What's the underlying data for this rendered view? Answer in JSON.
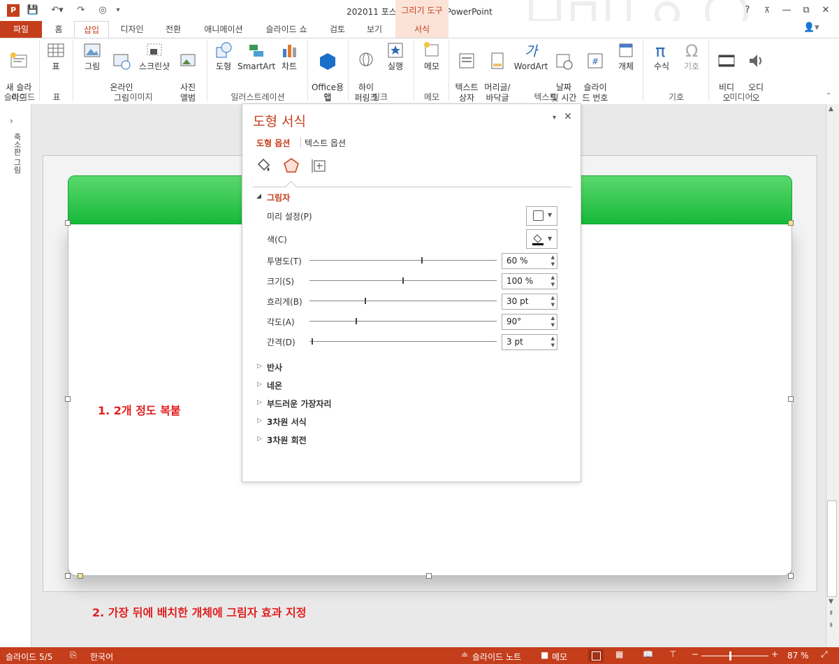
{
  "window": {
    "title": "202011 포스팅용 완성본 - PowerPoint",
    "contextual_title": "그리기 도구",
    "help": "?",
    "minimize": "—",
    "restore": "⧉",
    "close": "✕"
  },
  "tabs": [
    "파일",
    "홈",
    "삽입",
    "디자인",
    "전환",
    "애니메이션",
    "슬라이드 쇼",
    "검토",
    "보기",
    "서식"
  ],
  "ribbon": {
    "new_slide": "새 슬라\n이드",
    "table": "표",
    "picture": "그림",
    "online_picture": "온라인\n그림",
    "screenshot": "스크린샷",
    "photo_album": "사진\n앨범",
    "shapes": "도형",
    "smartart": "SmartArt",
    "chart": "차트",
    "office_app": "Office용\n앱",
    "hyperlink": "하이\n퍼링크",
    "action": "실행",
    "comment": "메모",
    "textbox": "텍스트\n상자",
    "header_footer": "머리글/\n바닥글",
    "wordart": "WordArt",
    "date_time": "날짜\n및 시간",
    "slide_number": "슬라이\n드 번호",
    "object": "개체",
    "equation": "수식",
    "symbol": "기호",
    "video": "비디\n오",
    "audio": "오디\n오",
    "groups": {
      "slides": "슬라이드",
      "tables": "표",
      "images": "이미지",
      "illustrations": "일러스트레이션",
      "apps": "앱",
      "links": "링크",
      "comments": "메모",
      "text": "텍스트",
      "symbols": "기호",
      "media": "미디어"
    }
  },
  "left_panel": {
    "label": "축소판 그림"
  },
  "slide": {
    "note1": "1. 2개 정도 복붙",
    "note2": "2. 가장 뒤에 배치한 개체에 그림자 효과 지정"
  },
  "pane": {
    "title": "도형 서식",
    "tab_shape": "도형 옵션",
    "tab_text": "텍스트 옵션",
    "shadow_header": "그림자",
    "preset_label": "미리 설정(P)",
    "color_label": "색(C)",
    "sliders": [
      {
        "label": "투명도(T)",
        "value": "60 %",
        "fraction": 0.6
      },
      {
        "label": "크기(S)",
        "value": "100 %",
        "fraction": 0.5
      },
      {
        "label": "흐리게(B)",
        "value": "30 pt",
        "fraction": 0.3
      },
      {
        "label": "각도(A)",
        "value": "90°",
        "fraction": 0.25
      },
      {
        "label": "간격(D)",
        "value": "3 pt",
        "fraction": 0.015
      }
    ],
    "sections": [
      "반사",
      "네온",
      "부드러운 가장자리",
      "3차원 서식",
      "3차원 회전"
    ]
  },
  "status": {
    "slide_pos": "슬라이드 5/5",
    "language": "한국어",
    "notes": "슬라이드 노트",
    "comments": "메모",
    "zoom": "87 %",
    "zoom_level": 0.87
  },
  "colors": {
    "accent": "#c43e1c",
    "green": "#1dbd42",
    "note_red": "#e01e1e"
  }
}
